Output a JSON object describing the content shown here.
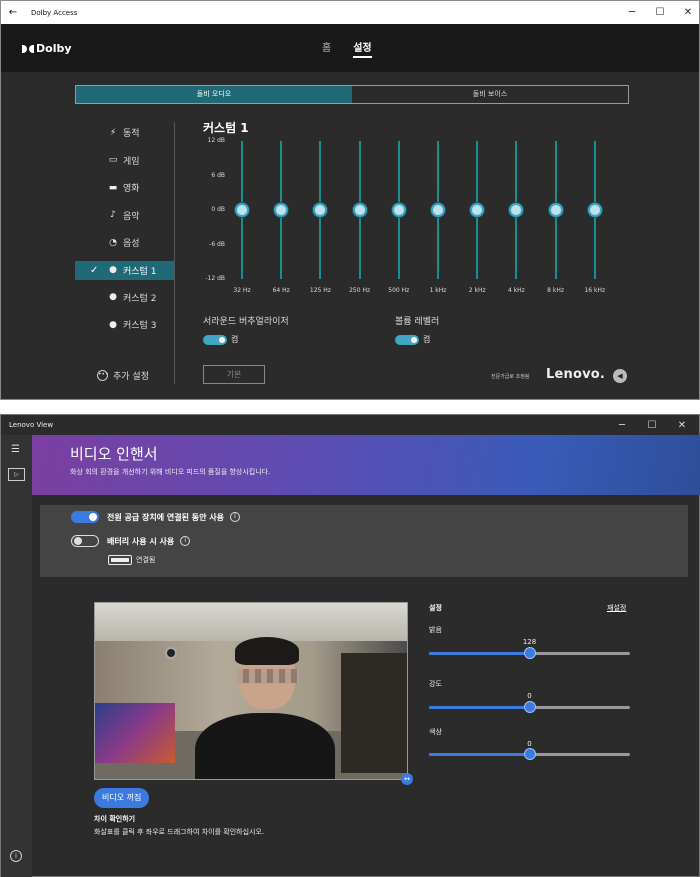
{
  "dolby": {
    "window_title": "Dolby Access",
    "brand": "Dolby",
    "nav": [
      "홈",
      "설정"
    ],
    "segments": [
      "돌비 오디오",
      "돌비 보이스"
    ],
    "profiles": [
      {
        "label": "동적",
        "icon": "bolt-icon",
        "glyph": "⚡"
      },
      {
        "label": "게임",
        "icon": "gamepad-icon",
        "glyph": "▭"
      },
      {
        "label": "영화",
        "icon": "clapperboard-icon",
        "glyph": "▬"
      },
      {
        "label": "음악",
        "icon": "music-note-icon",
        "glyph": "♪"
      },
      {
        "label": "음성",
        "icon": "voice-icon",
        "glyph": "◔"
      },
      {
        "label": "커스텀 1",
        "icon": "user-icon",
        "glyph": "●",
        "selected": true
      },
      {
        "label": "커스텀 2",
        "icon": "user-icon",
        "glyph": "●"
      },
      {
        "label": "커스텀 3",
        "icon": "user-icon",
        "glyph": "●"
      }
    ],
    "preset_title": "커스텀 1",
    "eq_db_labels": [
      "12 dB",
      "6 dB",
      "0 dB",
      "-6 dB",
      "-12 dB"
    ],
    "eq_bands": [
      "32 Hz",
      "64 Hz",
      "125 Hz",
      "250 Hz",
      "500 Hz",
      "1 kHz",
      "2 kHz",
      "4 kHz",
      "8 kHz",
      "16 kHz"
    ],
    "eq_gains_db": [
      0,
      0,
      0,
      0,
      0,
      0,
      0,
      0,
      0,
      0
    ],
    "surround_label": "서라운드 버추얼라이저",
    "surround_state": "켬",
    "leveler_label": "볼륨 레벨러",
    "leveler_state": "켬",
    "reset_button": "기본",
    "more_settings": "추가 설정",
    "tuned_by": "전문가급로 조정됨",
    "partner_logo": "Lenovo."
  },
  "lenovo_view": {
    "window_title": "Lenovo View",
    "heading": "비디오 인핸서",
    "subheading": "화상 회의 환경을 개선하기 위해 비디오 피드의 품질을 향상시킵니다.",
    "toggle_power_label": "전원 공급 장치에 연결된 동안 사용",
    "toggle_power_on": true,
    "toggle_battery_label": "배터리 사용 시 사용",
    "toggle_battery_on": false,
    "power_status": "연결됨",
    "video_off_button": "비디오 꺼짐",
    "diff_title": "차이 확인하기",
    "diff_desc": "화살표를 클릭 후 좌우로 드래그하여 차이를 확인하십시오.",
    "settings_title": "설정",
    "reset_link": "재설정",
    "sliders": [
      {
        "label": "밝음",
        "value": "128",
        "fraction": 0.5
      },
      {
        "label": "강도",
        "value": "0",
        "fraction": 0.5
      },
      {
        "label": "색상",
        "value": "0",
        "fraction": 0.5
      }
    ]
  }
}
